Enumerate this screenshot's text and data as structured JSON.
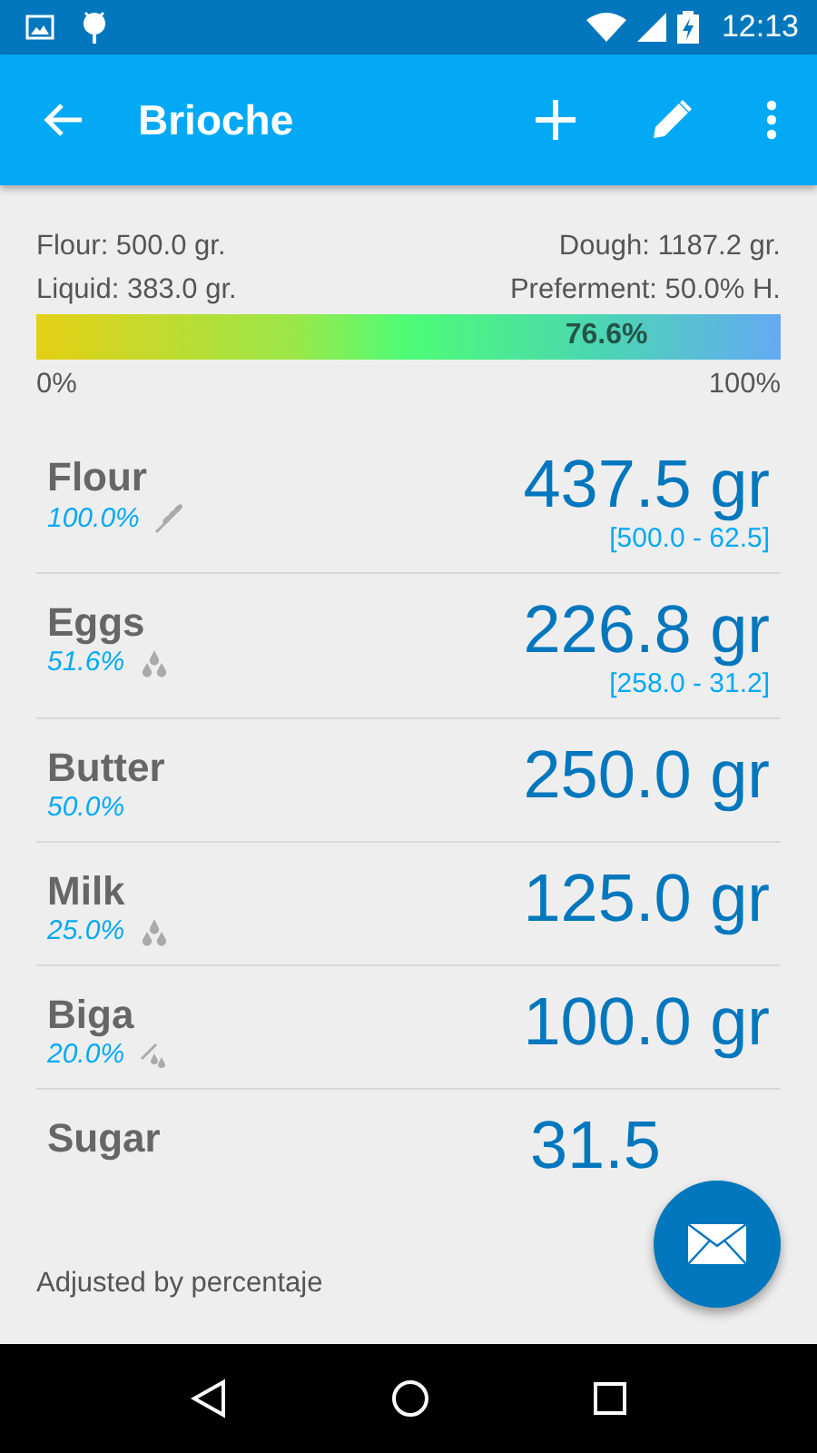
{
  "status_bar": {
    "time": "12:13"
  },
  "app_bar": {
    "title": "Brioche"
  },
  "summary": {
    "flour": "Flour: 500.0 gr.",
    "dough": "Dough: 1187.2 gr.",
    "liquid": "Liquid: 383.0 gr.",
    "preferment": "Preferment: 50.0% H.",
    "hydration": {
      "level": 0.766,
      "label": "76.6%"
    },
    "min_label": "0%",
    "max_label": "100%"
  },
  "ingredients": [
    {
      "name": "Flour",
      "percent": "100.0%",
      "kind": "flour",
      "amount": "437.5 gr",
      "range": "[500.0 - 62.5]"
    },
    {
      "name": "Eggs",
      "percent": "51.6%",
      "kind": "liquid",
      "amount": "226.8 gr",
      "range": "[258.0 - 31.2]"
    },
    {
      "name": "Butter",
      "percent": "50.0%",
      "kind": "plain",
      "amount": "250.0 gr"
    },
    {
      "name": "Milk",
      "percent": "25.0%",
      "kind": "liquid",
      "amount": "125.0 gr"
    },
    {
      "name": "Biga",
      "percent": "20.0%",
      "kind": "preferment",
      "amount": "100.0 gr"
    },
    {
      "name": "Sugar",
      "amount": "31.5"
    }
  ],
  "footer": "Adjusted by percentaje"
}
